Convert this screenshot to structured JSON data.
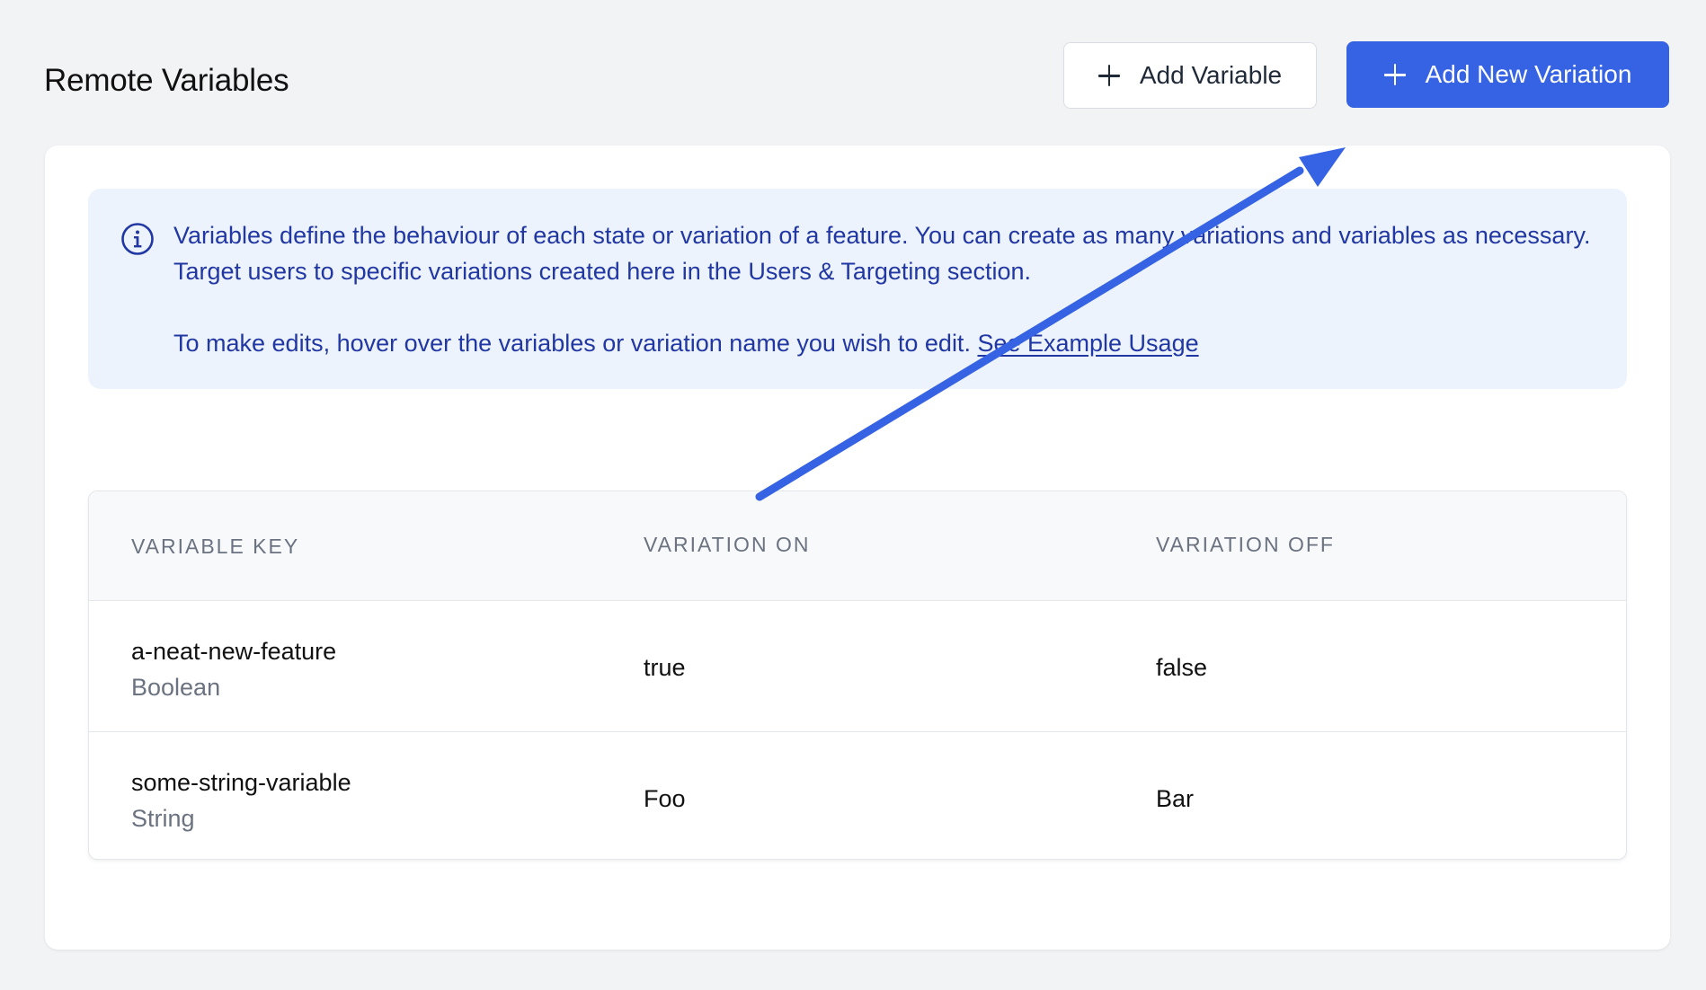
{
  "header": {
    "title": "Remote Variables",
    "add_variable_label": "Add Variable",
    "add_variation_label": "Add New Variation"
  },
  "info": {
    "paragraph1": "Variables define the behaviour of each state or variation of a feature. You can create as many variations and variables as necessary. Target users to specific variations created here in the Users & Targeting section.",
    "paragraph2": "To make edits, hover over the variables or variation name you wish to edit.",
    "link": "See Example Usage",
    "icon": "info-circle-icon"
  },
  "table": {
    "columns": [
      "VARIABLE KEY",
      "VARIATION ON",
      "VARIATION OFF"
    ],
    "rows": [
      {
        "key": "a-neat-new-feature",
        "type": "Boolean",
        "on": "true",
        "off": "false"
      },
      {
        "key": "some-string-variable",
        "type": "String",
        "on": "Foo",
        "off": "Bar"
      }
    ]
  },
  "colors": {
    "primary": "#3563e3",
    "info_bg": "#edf3fc",
    "info_text": "#2137a3",
    "annotation_arrow": "#3563e3"
  }
}
